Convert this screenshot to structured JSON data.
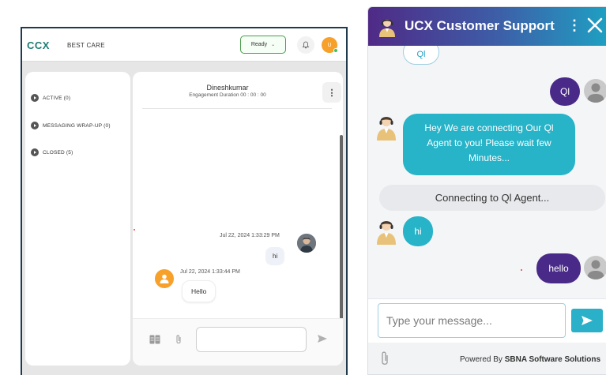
{
  "agent_console": {
    "brand": "CCX",
    "org_name": "BEST CARE",
    "status_select": {
      "value": "Ready"
    },
    "user_initials": "U",
    "queue": [
      {
        "label": "ACTIVE (0)"
      },
      {
        "label": "MESSAGING WRAP-UP (0)"
      },
      {
        "label": "CLOSED (5)"
      }
    ],
    "conversation": {
      "customer_name": "Dineshkumar",
      "engagement": "Engagement Duration 00 : 00 : 00",
      "messages": [
        {
          "timestamp": "Jul 22, 2024 1:33:29 PM",
          "text": "hi",
          "direction": "outgoing"
        },
        {
          "timestamp": "Jul 22, 2024 1:33:44 PM",
          "text": "Hello",
          "direction": "incoming"
        }
      ]
    }
  },
  "widget": {
    "title": "UCX Customer Support",
    "colors": {
      "header_start": "#4f2a86",
      "header_end": "#1f9fc2",
      "user_bubble": "#4a2a88",
      "bot_bubble": "#27b3c8"
    },
    "messages": {
      "quick_reply_chip": "Ql",
      "user_q1": "Ql",
      "bot_connecting": "Hey We are connecting Our Ql Agent to you! Please wait few Minutes...",
      "system_status": "Connecting to Ql Agent...",
      "bot_hi": "hi",
      "user_hello": "hello"
    },
    "input": {
      "placeholder": "Type your message..."
    },
    "footer": {
      "powered_prefix": "Powered By",
      "powered_company": "SBNA Software Solutions"
    }
  }
}
